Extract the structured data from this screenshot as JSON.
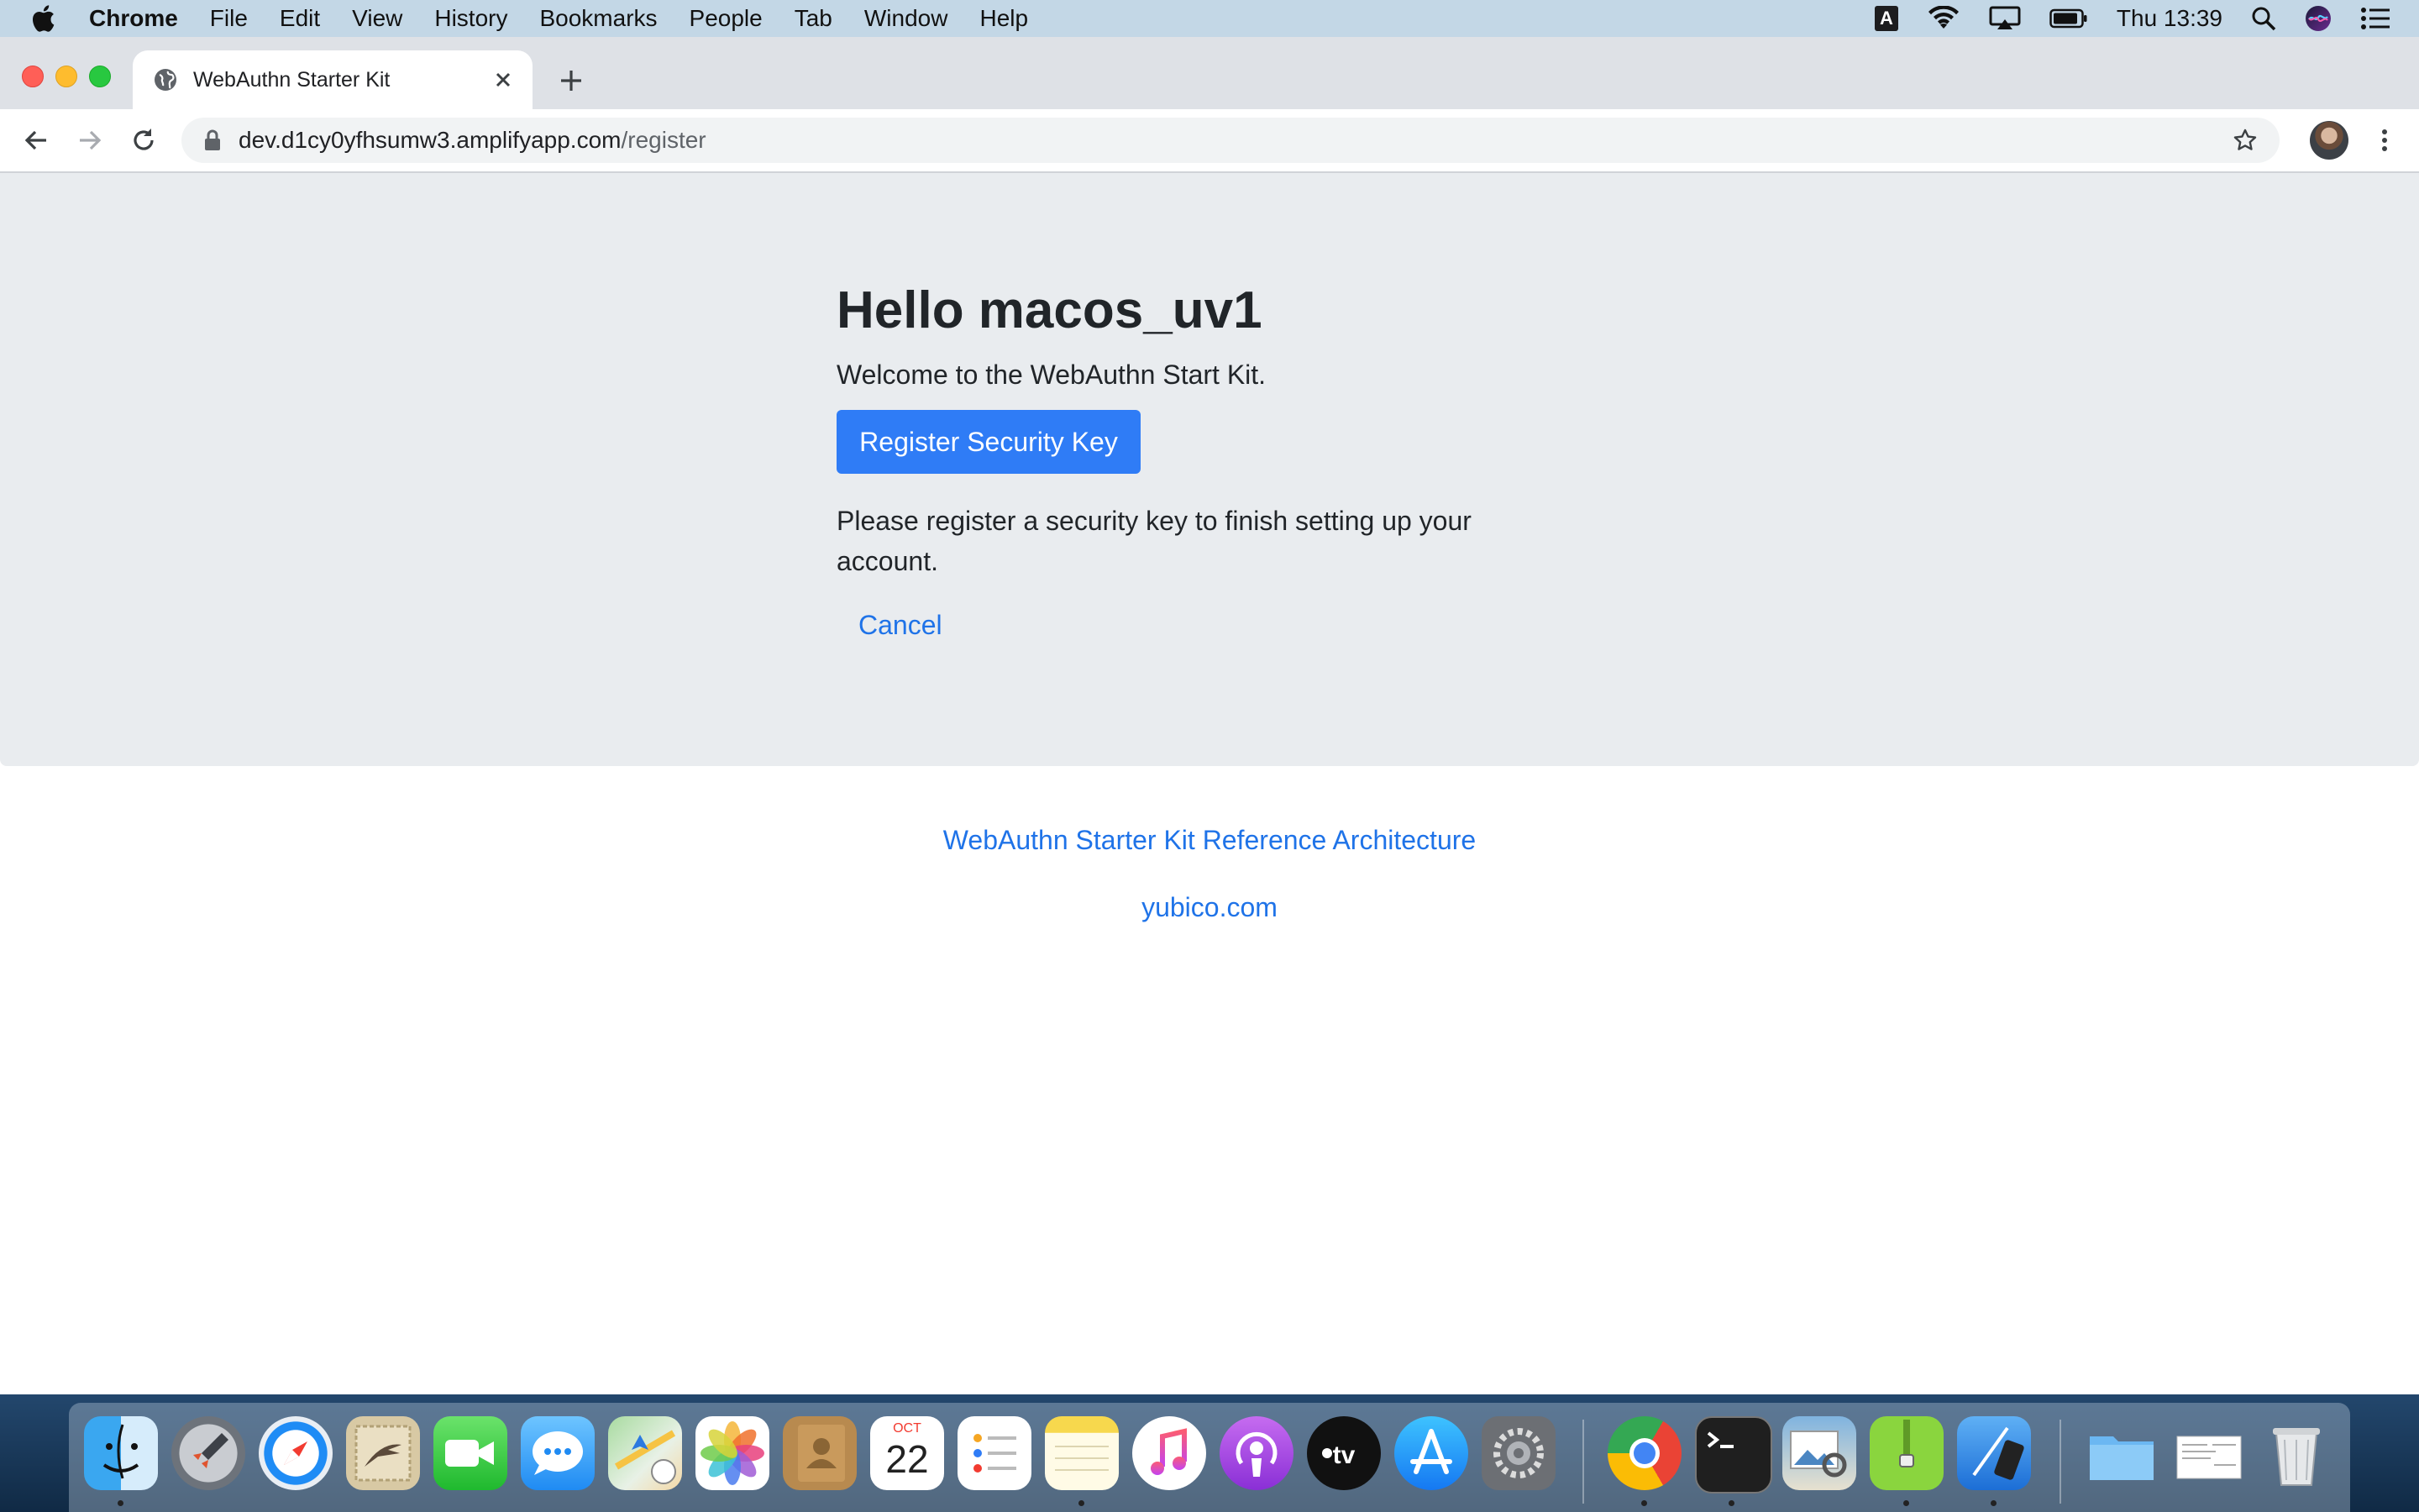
{
  "menubar": {
    "app": "Chrome",
    "items": [
      "File",
      "Edit",
      "View",
      "History",
      "Bookmarks",
      "People",
      "Tab",
      "Window",
      "Help"
    ],
    "input_source": "A",
    "clock": "Thu 13:39"
  },
  "browser": {
    "tab_title": "WebAuthn Starter Kit",
    "url_host": "dev.d1cy0yfhsumw3.amplifyapp.com",
    "url_path": "/register"
  },
  "page": {
    "heading": "Hello macos_uv1",
    "welcome": "Welcome to the WebAuthn Start Kit.",
    "register_button": "Register Security Key",
    "instructions": "Please register a security key to finish setting up your account.",
    "cancel_link": "Cancel",
    "footer_link_1": "WebAuthn Starter Kit Reference Architecture",
    "footer_link_2": "yubico.com"
  },
  "dock": {
    "calendar_month": "OCT",
    "calendar_day": "22",
    "apps": [
      "finder",
      "launchpad",
      "safari",
      "mail",
      "facetime",
      "messages",
      "maps",
      "photos",
      "contacts",
      "calendar",
      "reminders",
      "notes",
      "music",
      "podcasts",
      "tv",
      "app-store",
      "system-preferences",
      "chrome",
      "terminal",
      "preview",
      "archive-utility",
      "xcode",
      "downloads-folder",
      "documents-stack",
      "trash"
    ]
  },
  "colors": {
    "primary_button": "#2f7cf6",
    "link": "#1f73e8",
    "jumbotron": "#e9ecef"
  }
}
